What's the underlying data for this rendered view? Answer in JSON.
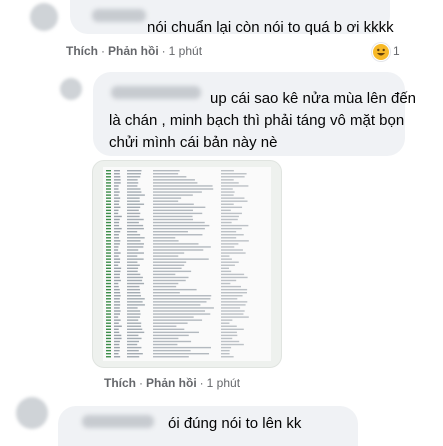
{
  "comments": [
    {
      "text": "nói chuẩn lại còn nói to quá b ơi kkkk",
      "actions": {
        "like": "Thích",
        "reply": "Phản hồi",
        "separator": "·",
        "time": "1 phút"
      },
      "reaction": {
        "icon": "haha-emoji-icon",
        "count": "1"
      }
    },
    {
      "text_lines": [
        "up cái sao kê nửa mùa lên đến",
        "là chán , minh bạch thì phải táng vô mặt bọn",
        "chửi mình cái bản này nè"
      ],
      "attachment": {
        "icon": "document-screenshot-image"
      },
      "actions": {
        "like": "Thích",
        "reply": "Phản hồi",
        "separator": "·",
        "time": "1 phút"
      }
    },
    {
      "text": "ói đúng nói to lên kk"
    }
  ],
  "colors": {
    "bubble": "#f0f2f5",
    "meta_text": "#65676b",
    "reaction": "#f7b928"
  }
}
